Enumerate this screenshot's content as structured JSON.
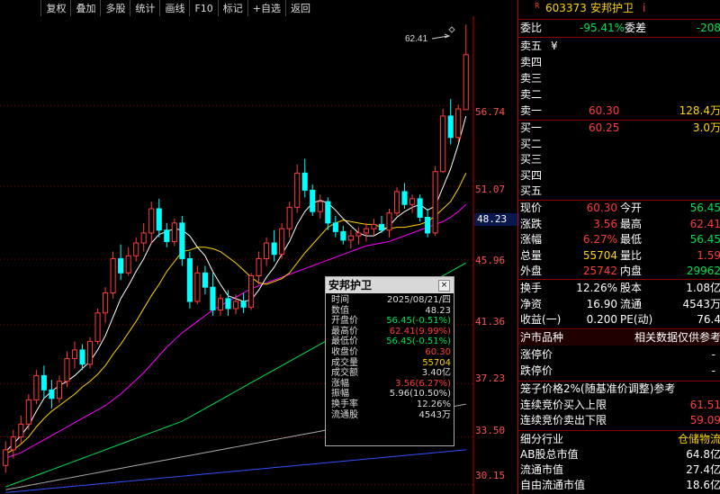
{
  "toolbar": [
    "复权",
    "叠加",
    "多股",
    "统计",
    "画线",
    "F10",
    "标记",
    "+自选",
    "返回"
  ],
  "chart": {
    "price_labels": [
      "56.74",
      "51.07",
      "45.96",
      "41.36",
      "37.23",
      "33.50",
      "30.15"
    ],
    "current_price_label": "48.23",
    "high_marker": "62.41"
  },
  "popup": {
    "title": "安邦护卫",
    "rows": [
      {
        "label": "时间",
        "value": "2025/08/21/四",
        "color": "#ddd"
      },
      {
        "label": "数值",
        "value": "48.23",
        "color": "#ddd"
      },
      {
        "label": "开盘价",
        "value": "56.45(-0.51%)",
        "color": "#00e050"
      },
      {
        "label": "最高价",
        "value": "62.41(9.99%)",
        "color": "#ff3b3b"
      },
      {
        "label": "最低价",
        "value": "56.45(-0.51%)",
        "color": "#00e050"
      },
      {
        "label": "收盘价",
        "value": "60.30",
        "color": "#ff3b3b"
      },
      {
        "label": "成交量",
        "value": "55704",
        "color": "#ffd400"
      },
      {
        "label": "成交额",
        "value": "3.40亿",
        "color": "#ddd"
      },
      {
        "label": "涨幅",
        "value": "3.56(6.27%)",
        "color": "#ff3b3b"
      },
      {
        "label": "振幅",
        "value": "5.96(10.50%)",
        "color": "#ddd"
      },
      {
        "label": "换手率",
        "value": "12.26%",
        "color": "#ddd"
      },
      {
        "label": "流通股",
        "value": "4543万",
        "color": "#ddd"
      }
    ]
  },
  "panel": {
    "r_mark": "R",
    "code": "603373",
    "name": "安邦护卫",
    "i_mark": "i",
    "weibi_label": "委比",
    "weibi_value": "-95.41%",
    "weicha_label": "委差",
    "weicha_value": "-208",
    "sell_labels": [
      "卖五",
      "卖四",
      "卖三",
      "卖二",
      "卖一"
    ],
    "sell_yen": "¥",
    "sell1_price": "60.30",
    "sell1_vol": "128.4万",
    "buy_labels": [
      "买一",
      "买二",
      "买三",
      "买四",
      "买五"
    ],
    "buy1_price": "60.25",
    "buy1_vol": "3.0万",
    "quote": [
      {
        "l": "现价",
        "v": "60.30",
        "vc": "red",
        "l2": "今开",
        "v2": "56.45",
        "v2c": "grn"
      },
      {
        "l": "涨跌",
        "v": "3.56",
        "vc": "red",
        "l2": "最高",
        "v2": "62.41",
        "v2c": "red"
      },
      {
        "l": "涨幅",
        "v": "6.27%",
        "vc": "red",
        "l2": "最低",
        "v2": "56.45",
        "v2c": "grn"
      },
      {
        "l": "总量",
        "v": "55704",
        "vc": "yel",
        "l2": "量比",
        "v2": "1.59",
        "v2c": "red"
      },
      {
        "l": "外盘",
        "v": "25742",
        "vc": "red",
        "l2": "内盘",
        "v2": "29962",
        "v2c": "grn"
      }
    ],
    "stats": [
      {
        "l": "换手",
        "v": "12.26%",
        "l2": "股本",
        "v2": "1.08亿"
      },
      {
        "l": "净资",
        "v": "16.90",
        "l2": "流通",
        "v2": "4543万"
      },
      {
        "l": "收益(一)",
        "v": "0.200",
        "l2": "PE(动)",
        "v2": "76.4"
      }
    ],
    "market_label": "沪市品种",
    "market_note": "相关数据仅供参考",
    "limit_up_label": "涨停价",
    "limit_up_value": "-",
    "limit_down_label": "跌停价",
    "limit_down_value": "-",
    "cage_text": "笼子价格2%(随基准价调整)参考",
    "auction_buy_label": "连续竞价买入上限",
    "auction_buy_value": "61.51",
    "auction_sell_label": "连续竞价卖出下限",
    "auction_sell_value": "59.09",
    "industry_label": "细分行业",
    "industry_value": "仓储物流",
    "ab_label": "AB股总市值",
    "ab_value": "64.8亿",
    "float_label": "流通市值",
    "float_value": "27.4亿",
    "free_label": "自由流通市值",
    "free_value": "18.6亿"
  },
  "chart_data": {
    "type": "candlestick",
    "ylim": [
      29.5,
      63
    ],
    "y_ticks": [
      56.74,
      51.07,
      45.96,
      41.36,
      37.23,
      33.5,
      30.15
    ],
    "candles": [
      [
        31.5,
        33.2,
        31.0,
        32.6
      ],
      [
        32.6,
        34.0,
        32.0,
        33.5
      ],
      [
        33.5,
        35.0,
        33.0,
        34.4
      ],
      [
        34.4,
        36.5,
        34.0,
        36.1
      ],
      [
        36.1,
        38.2,
        35.8,
        37.8
      ],
      [
        37.8,
        38.5,
        36.2,
        36.8
      ],
      [
        36.8,
        37.5,
        35.5,
        36.2
      ],
      [
        36.2,
        37.8,
        35.9,
        37.4
      ],
      [
        37.4,
        39.5,
        37.0,
        39.0
      ],
      [
        39.0,
        40.2,
        38.3,
        39.6
      ],
      [
        39.6,
        40.0,
        38.2,
        38.6
      ],
      [
        38.6,
        40.5,
        38.3,
        40.2
      ],
      [
        40.2,
        42.5,
        40.0,
        42.2
      ],
      [
        42.2,
        44.0,
        41.5,
        43.6
      ],
      [
        43.6,
        46.5,
        43.2,
        46.0
      ],
      [
        46.0,
        47.0,
        44.5,
        45.0
      ],
      [
        45.0,
        46.8,
        44.8,
        46.2
      ],
      [
        46.2,
        47.5,
        45.8,
        47.1
      ],
      [
        47.1,
        48.5,
        46.5,
        47.8
      ],
      [
        47.8,
        50.0,
        47.0,
        49.5
      ],
      [
        49.5,
        50.2,
        47.5,
        48.0
      ],
      [
        48.0,
        48.5,
        46.8,
        47.2
      ],
      [
        47.2,
        48.8,
        46.9,
        48.5
      ],
      [
        48.5,
        49.0,
        45.5,
        46.0
      ],
      [
        46.0,
        46.5,
        42.5,
        43.0
      ],
      [
        43.0,
        45.5,
        42.8,
        45.0
      ],
      [
        45.0,
        45.5,
        43.5,
        44.0
      ],
      [
        44.0,
        45.0,
        42.0,
        42.4
      ],
      [
        42.4,
        43.5,
        42.0,
        43.2
      ],
      [
        43.2,
        43.8,
        42.0,
        42.5
      ],
      [
        42.5,
        43.5,
        42.1,
        43.0
      ],
      [
        43.0,
        43.6,
        42.2,
        42.6
      ],
      [
        42.6,
        45.0,
        42.4,
        44.8
      ],
      [
        44.8,
        46.5,
        44.2,
        46.0
      ],
      [
        46.0,
        47.5,
        45.5,
        47.1
      ],
      [
        47.1,
        48.0,
        45.8,
        46.3
      ],
      [
        46.3,
        48.5,
        46.0,
        48.1
      ],
      [
        48.1,
        50.0,
        47.5,
        49.6
      ],
      [
        49.6,
        52.6,
        49.2,
        52.0
      ],
      [
        52.0,
        53.0,
        50.3,
        50.8
      ],
      [
        50.8,
        51.2,
        49.0,
        49.3
      ],
      [
        49.3,
        50.5,
        48.8,
        50.0
      ],
      [
        50.0,
        50.3,
        48.0,
        48.5
      ],
      [
        48.5,
        49.0,
        47.5,
        47.9
      ],
      [
        47.9,
        48.3,
        47.0,
        47.3
      ],
      [
        47.3,
        48.0,
        46.7,
        47.6
      ],
      [
        47.6,
        48.2,
        47.0,
        47.8
      ],
      [
        47.8,
        48.5,
        47.2,
        48.1
      ],
      [
        48.1,
        48.8,
        47.6,
        48.4
      ],
      [
        48.4,
        49.0,
        47.8,
        48.0
      ],
      [
        48.0,
        49.5,
        47.5,
        49.2
      ],
      [
        49.2,
        51.0,
        49.0,
        50.7
      ],
      [
        50.7,
        51.3,
        49.5,
        49.8
      ],
      [
        49.8,
        50.5,
        49.2,
        50.2
      ],
      [
        50.2,
        50.5,
        48.6,
        48.9
      ],
      [
        48.9,
        49.5,
        47.5,
        47.8
      ],
      [
        47.8,
        52.5,
        47.6,
        52.1
      ],
      [
        52.1,
        56.5,
        52.0,
        56.0
      ],
      [
        56.0,
        57.2,
        54.0,
        54.5
      ],
      [
        54.5,
        56.8,
        54.2,
        56.5
      ],
      [
        56.45,
        62.41,
        56.45,
        60.3
      ]
    ],
    "ma5": [
      32.5,
      33.0,
      33.6,
      34.3,
      35.3,
      36.2,
      36.7,
      37.1,
      37.4,
      37.8,
      38.3,
      38.8,
      39.6,
      40.6,
      41.9,
      43.2,
      44.1,
      45.1,
      46.0,
      47.1,
      47.7,
      47.9,
      48.1,
      48.0,
      47.6,
      46.8,
      46.2,
      45.1,
      44.2,
      43.4,
      43.2,
      43.0,
      43.1,
      43.8,
      44.7,
      45.4,
      46.3,
      47.2,
      48.4,
      49.3,
      49.9,
      50.1,
      49.9,
      49.4,
      48.8,
      48.3,
      47.8,
      47.6,
      47.6,
      47.9,
      48.3,
      48.9,
      49.3,
      49.6,
      49.8,
      49.4,
      49.7,
      51.0,
      52.3,
      54.0,
      56.0
    ],
    "ma10": [
      32.3,
      32.6,
      33.0,
      33.5,
      34.2,
      34.8,
      35.3,
      35.7,
      36.1,
      36.5,
      37.0,
      37.4,
      37.9,
      38.5,
      39.3,
      40.0,
      40.8,
      41.6,
      42.5,
      43.4,
      44.2,
      45.1,
      45.8,
      46.5,
      46.6,
      46.8,
      46.8,
      46.7,
      46.5,
      46.1,
      45.7,
      45.2,
      44.7,
      44.3,
      44.2,
      44.4,
      44.6,
      45.0,
      45.7,
      46.4,
      47.0,
      47.6,
      48.2,
      48.5,
      48.7,
      48.6,
      48.5,
      48.4,
      48.4,
      48.2,
      48.1,
      48.2,
      48.2,
      48.3,
      48.4,
      48.6,
      49.0,
      49.5,
      50.0,
      50.9,
      52.0
    ],
    "ma20": [
      32.0,
      32.2,
      32.4,
      32.7,
      33.0,
      33.3,
      33.6,
      33.9,
      34.2,
      34.5,
      34.8,
      35.1,
      35.4,
      35.7,
      36.1,
      36.5,
      37.0,
      37.5,
      38.0,
      38.6,
      39.2,
      39.8,
      40.3,
      40.8,
      41.2,
      41.6,
      42.0,
      42.4,
      42.7,
      43.0,
      43.3,
      43.6,
      43.9,
      44.1,
      44.3,
      44.5,
      44.7,
      44.9,
      45.1,
      45.3,
      45.5,
      45.7,
      45.9,
      46.1,
      46.3,
      46.5,
      46.7,
      46.9,
      47.0,
      47.1,
      47.2,
      47.4,
      47.6,
      47.8,
      48.0,
      48.2,
      48.4,
      48.6,
      48.9,
      49.3,
      49.8
    ],
    "ma60": [
      30.0,
      30.2,
      30.4,
      30.6,
      30.8,
      31.0,
      31.2,
      31.4,
      31.6,
      31.8,
      32.0,
      32.2,
      32.4,
      32.6,
      32.8,
      33.0,
      33.2,
      33.4,
      33.6,
      33.8,
      34.0,
      34.2,
      34.4,
      34.6,
      34.9,
      35.2,
      35.5,
      35.8,
      36.1,
      36.4,
      36.7,
      37.0,
      37.3,
      37.6,
      37.9,
      38.2,
      38.5,
      38.8,
      39.1,
      39.4,
      39.7,
      40.0,
      40.3,
      40.6,
      40.9,
      41.2,
      41.5,
      41.8,
      42.1,
      42.4,
      42.7,
      43.0,
      43.3,
      43.6,
      43.9,
      44.2,
      44.5,
      44.8,
      45.1,
      45.4,
      45.7
    ],
    "ma120": [
      29.8,
      29.9,
      30.0,
      30.1,
      30.2,
      30.3,
      30.4,
      30.5,
      30.6,
      30.7,
      30.8,
      30.9,
      31.0,
      31.1,
      31.2,
      31.3,
      31.4,
      31.5,
      31.6,
      31.7,
      31.8,
      31.9,
      32.0,
      32.1,
      32.2,
      32.3,
      32.4,
      32.5,
      32.6,
      32.7,
      32.8,
      32.9,
      33.0,
      33.1,
      33.2,
      33.3,
      33.4,
      33.5,
      33.6,
      33.7,
      33.8,
      33.9,
      34.0,
      34.1,
      34.2,
      34.3,
      34.4,
      34.5,
      34.6,
      34.7,
      34.8,
      34.9,
      35.0,
      35.1,
      35.2,
      35.3,
      35.4,
      35.5,
      35.6,
      35.7,
      35.8
    ],
    "ma250": [
      29.6,
      29.65,
      29.7,
      29.75,
      29.8,
      29.85,
      29.9,
      29.95,
      30.0,
      30.05,
      30.1,
      30.15,
      30.2,
      30.25,
      30.3,
      30.35,
      30.4,
      30.45,
      30.5,
      30.55,
      30.6,
      30.65,
      30.7,
      30.75,
      30.8,
      30.85,
      30.9,
      30.95,
      31.0,
      31.05,
      31.1,
      31.15,
      31.2,
      31.25,
      31.3,
      31.35,
      31.4,
      31.45,
      31.5,
      31.55,
      31.6,
      31.65,
      31.7,
      31.75,
      31.8,
      31.85,
      31.9,
      31.95,
      32.0,
      32.05,
      32.1,
      32.15,
      32.2,
      32.25,
      32.3,
      32.35,
      32.4,
      32.45,
      32.5,
      32.55,
      32.6
    ],
    "colors": {
      "up": "#ff3b3b",
      "down": "#00ffff",
      "ma5": "#ffffff",
      "ma10": "#ffd400",
      "ma20": "#ff00ff",
      "ma60": "#00e050",
      "ma120": "#aaaaaa",
      "ma250": "#3050ff"
    }
  }
}
